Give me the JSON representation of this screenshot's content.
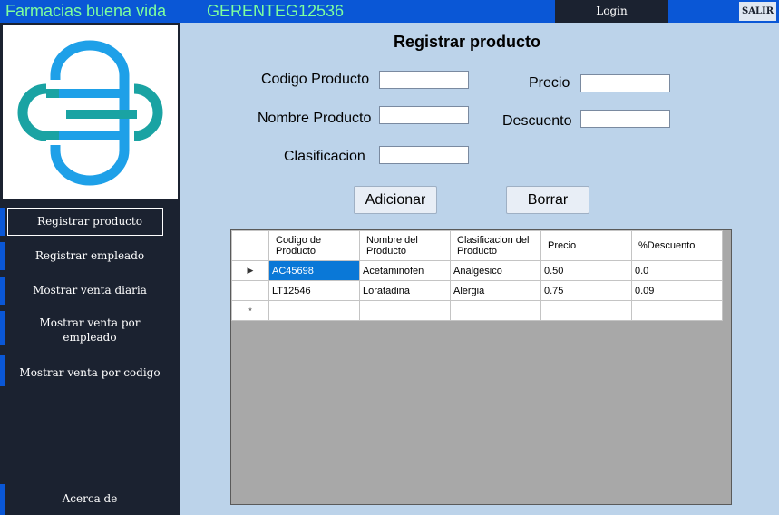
{
  "header": {
    "app_title": "Farmacias buena vida",
    "user_id": "GERENTEG12536",
    "login_label": "Login",
    "exit_label": "SALIR"
  },
  "sidebar": {
    "items": [
      {
        "label": "Registrar producto"
      },
      {
        "label": "Registrar empleado"
      },
      {
        "label": "Mostrar venta diaria"
      },
      {
        "label": "Mostrar venta por empleado"
      },
      {
        "label": "Mostrar venta por codigo"
      },
      {
        "label": "Acerca de"
      }
    ]
  },
  "form": {
    "title": "Registrar producto",
    "codigo_label": "Codigo Producto",
    "nombre_label": "Nombre Producto",
    "clasificacion_label": "Clasificacion",
    "precio_label": "Precio",
    "descuento_label": "Descuento",
    "codigo_value": "",
    "nombre_value": "",
    "clasificacion_value": "",
    "precio_value": "",
    "descuento_value": "",
    "add_button": "Adicionar",
    "delete_button": "Borrar"
  },
  "grid": {
    "columns": [
      "Codigo de Producto",
      "Nombre del Producto",
      "Clasificacion del Producto",
      "Precio",
      "%Descuento"
    ],
    "rows": [
      [
        "AC45698",
        "Acetaminofen",
        "Analgesico",
        "0.50",
        "0.0"
      ],
      [
        "LT12546",
        "Loratadina",
        "Alergia",
        "0.75",
        "0.09"
      ]
    ],
    "current_row_marker": "▶",
    "new_row_marker": "*"
  },
  "colors": {
    "topbar": "#0a57d6",
    "sidebar": "#1b2230",
    "content_bg": "#bcd3ea",
    "header_text": "#7dff9e",
    "logo_blue": "#1ea0e8",
    "logo_teal": "#1aa3a3",
    "selection": "#0a78d7"
  }
}
